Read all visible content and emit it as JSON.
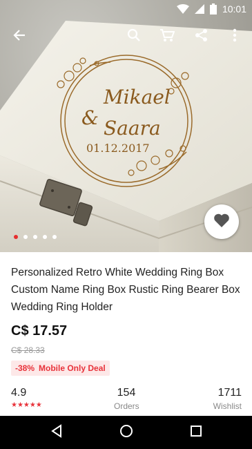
{
  "status_bar": {
    "time": "10:01",
    "battery_level": "2"
  },
  "toolbar": {
    "back_icon": "arrow-left-icon",
    "search_icon": "search-icon",
    "cart_icon": "cart-icon",
    "share_icon": "share-icon",
    "more_icon": "more-vert-icon"
  },
  "product": {
    "image_engraving": {
      "name1": "Mikael",
      "amp": "&",
      "name2": "Saara",
      "date": "01.12.2017"
    },
    "title": "Personalized Retro White Wedding Ring Box Custom Name Ring Box Rustic Ring Bearer Box Wedding Ring Holder",
    "price": "C$ 17.57",
    "old_price": "C$ 28.33",
    "discount": "-38%",
    "deal_label": "Mobile Only Deal",
    "carousel": {
      "count": 5,
      "active_index": 0
    }
  },
  "stats": {
    "rating": "4.9",
    "rating_stars": 5,
    "orders_count": "154",
    "orders_label": "Orders",
    "wishlist_count": "1711",
    "wishlist_label": "Wishlist"
  },
  "colors": {
    "accent": "#e8323a",
    "deal_bg": "#fde8e8"
  }
}
